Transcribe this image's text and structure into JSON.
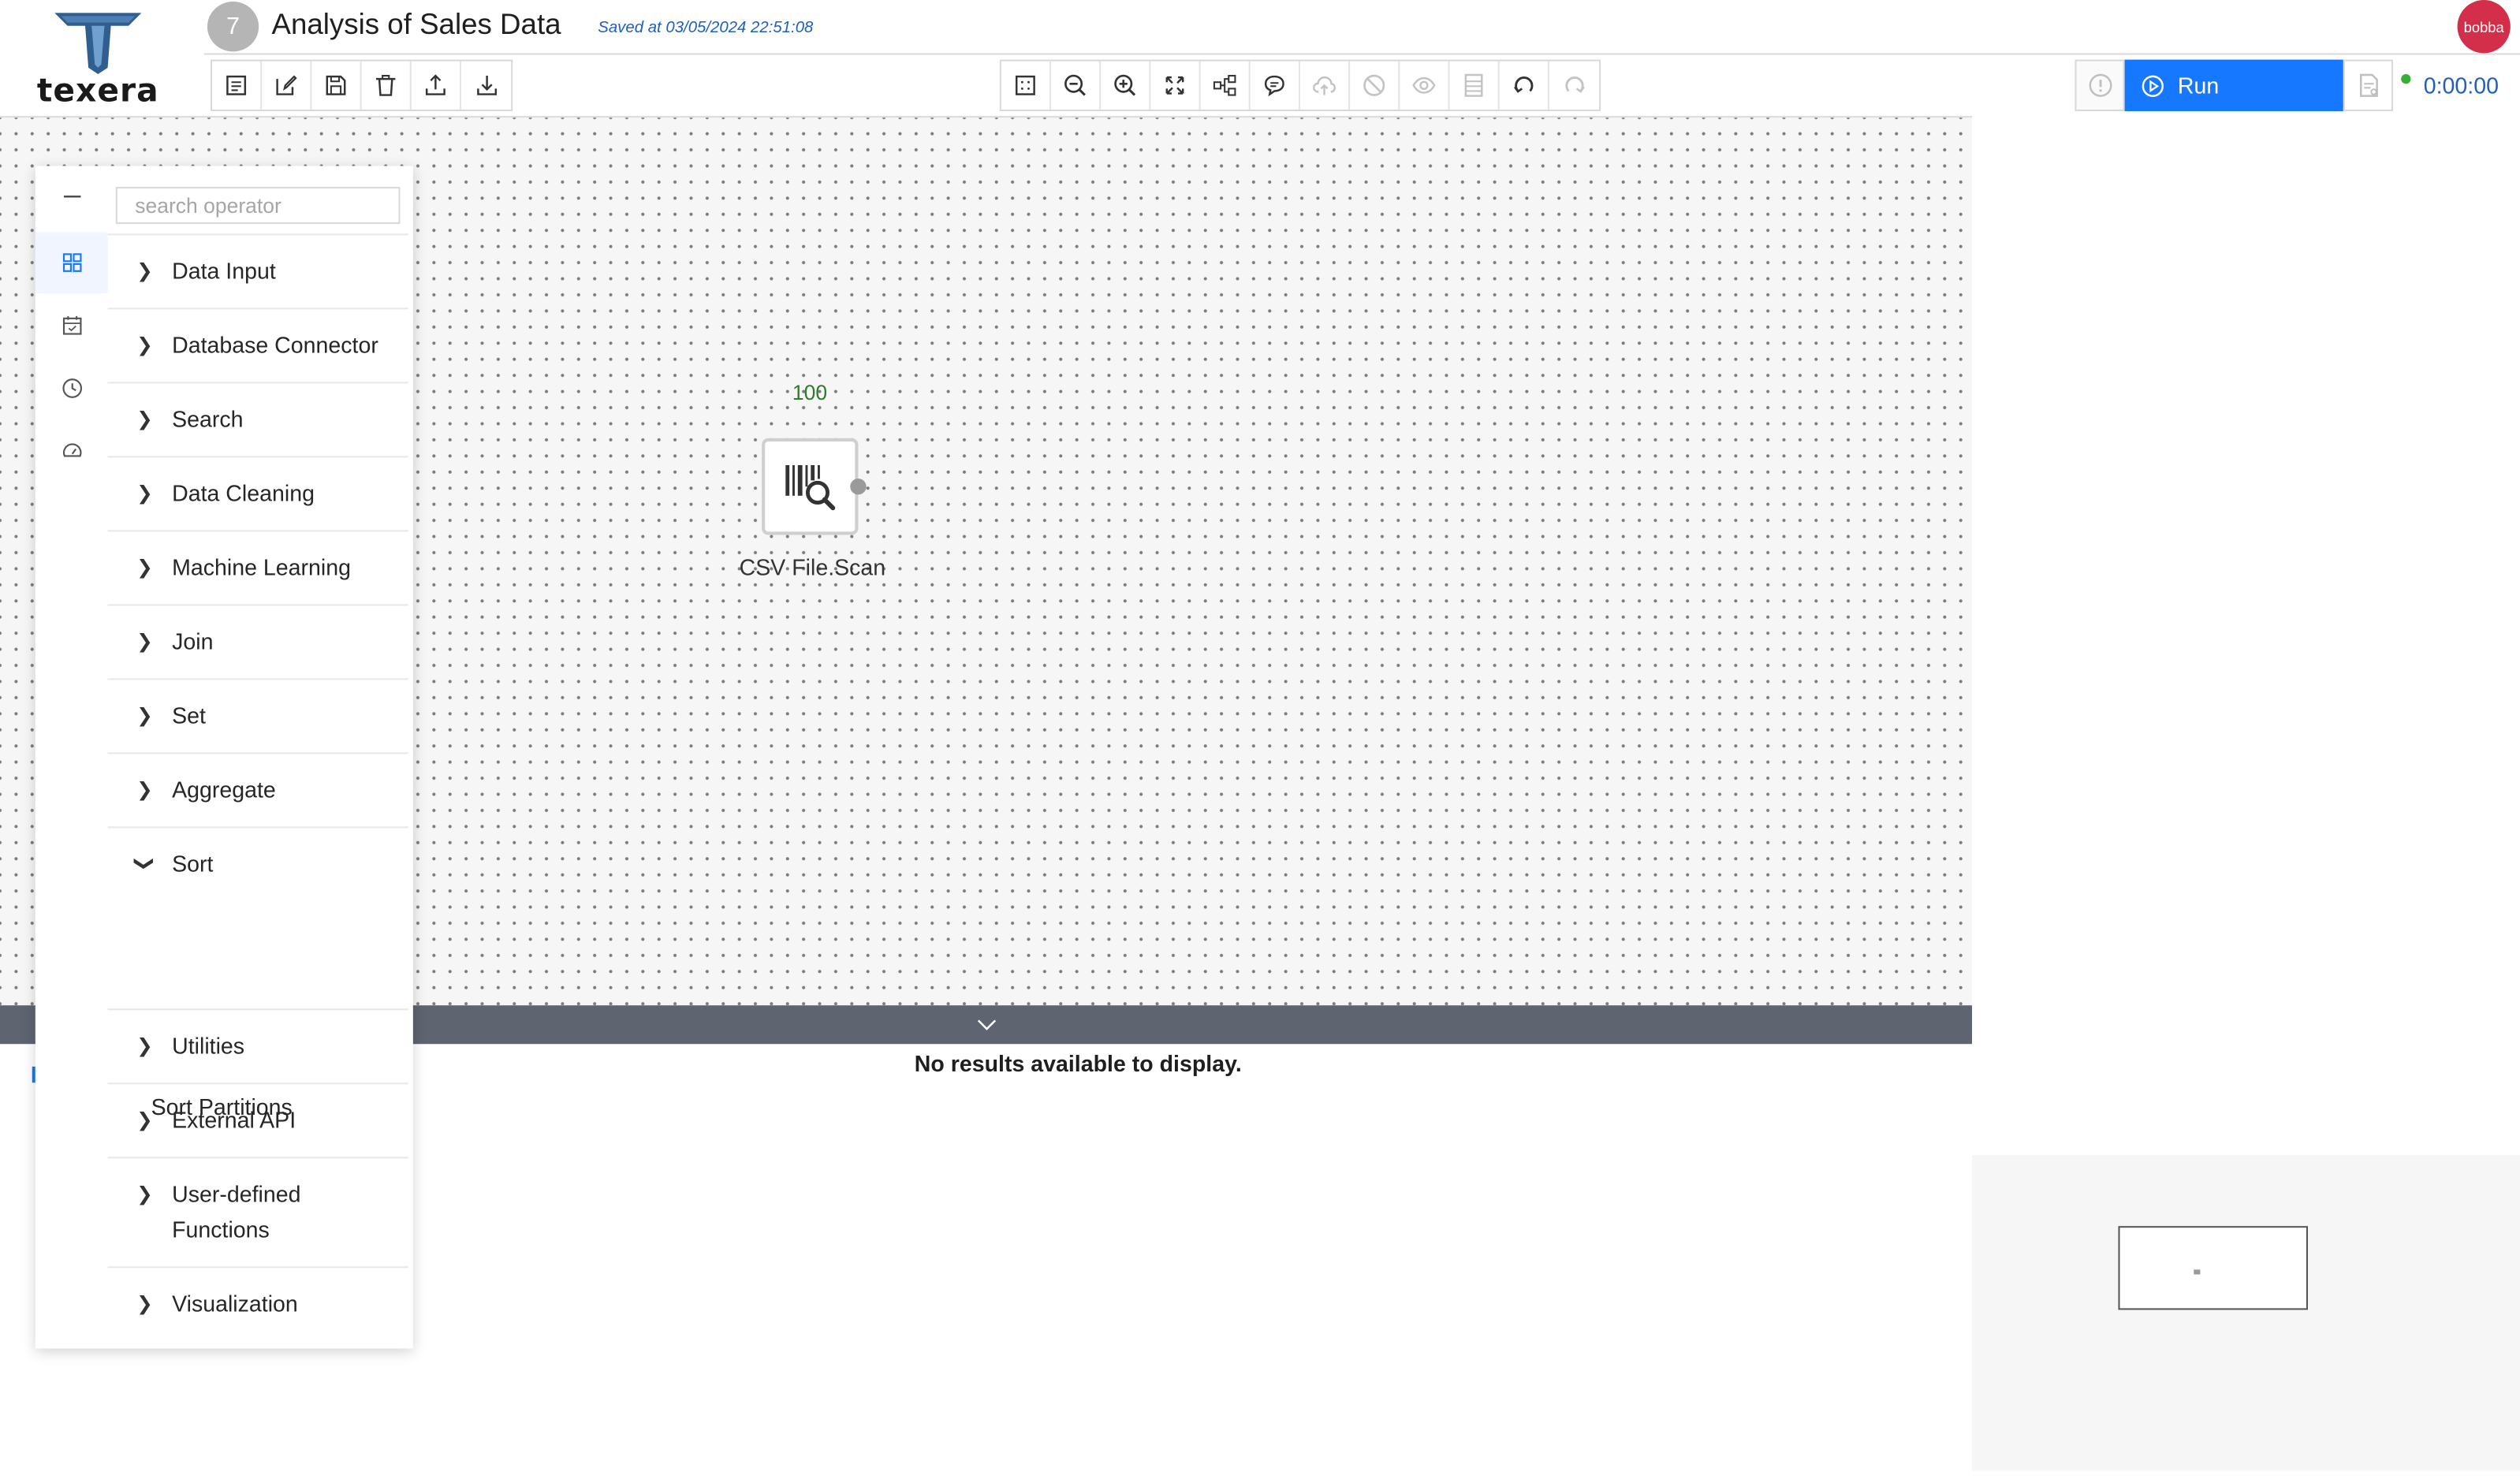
{
  "app": {
    "logo_text": "texera",
    "workflow_id": "7",
    "workflow_title": "Analysis of Sales Data",
    "saved_status": "Saved at 03/05/2024 22:51:08",
    "user_avatar": "bobba"
  },
  "toolbar": {
    "left_buttons": [
      "properties-icon",
      "edit-icon",
      "save-icon",
      "delete-icon",
      "upload-icon",
      "download-icon"
    ],
    "center_buttons": [
      "grid-icon",
      "zoom-out-icon",
      "zoom-in-icon",
      "fit-icon",
      "layout-icon",
      "comment-icon",
      "cloud-icon",
      "disable-icon",
      "view-icon",
      "cache-icon",
      "undo-icon",
      "redo-icon"
    ],
    "run_label": "Run",
    "timer": "0:00:00"
  },
  "operator_menu": {
    "search_placeholder": "search operator",
    "categories": [
      {
        "label": "Data Input",
        "expanded": false
      },
      {
        "label": "Database Connector",
        "expanded": false
      },
      {
        "label": "Search",
        "expanded": false
      },
      {
        "label": "Data Cleaning",
        "expanded": false
      },
      {
        "label": "Machine Learning",
        "expanded": false
      },
      {
        "label": "Join",
        "expanded": false
      },
      {
        "label": "Set",
        "expanded": false
      },
      {
        "label": "Aggregate",
        "expanded": false
      },
      {
        "label": "Sort",
        "expanded": true
      },
      {
        "label": "Utilities",
        "expanded": false
      },
      {
        "label": "External API",
        "expanded": false
      },
      {
        "label": "User-defined Functions",
        "expanded": false
      },
      {
        "label": "Visualization",
        "expanded": false
      }
    ],
    "sort_items": [
      "Sort Partitions"
    ]
  },
  "canvas": {
    "operator": {
      "count": "100",
      "label": "CSV File.Scan",
      "icon": "csv-scan-icon"
    }
  },
  "result_panel": {
    "message": "No results available to display."
  }
}
